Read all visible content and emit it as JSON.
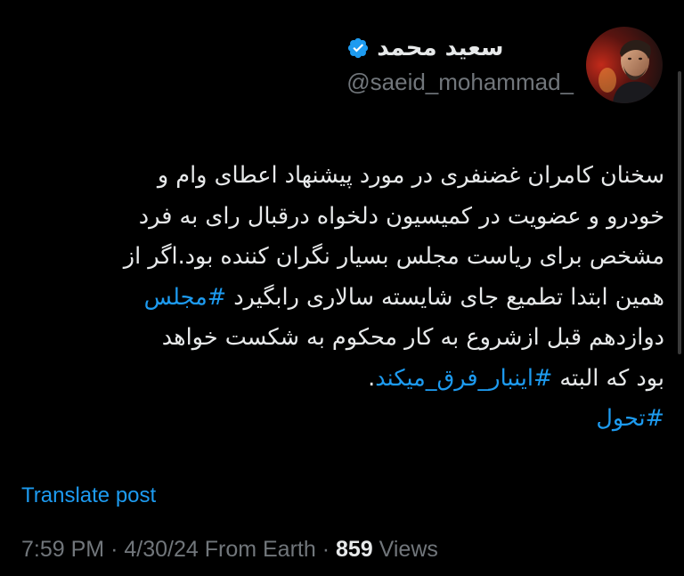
{
  "author": {
    "display_name": "سعید محمد",
    "handle": "@saeid_mohammad_",
    "verified": true,
    "verified_color": "#1d9bf0",
    "avatar_icon": "profile-photo"
  },
  "more_icon": "ellipsis-icon",
  "tweet": {
    "lines": [
      [
        {
          "text": "سخنان کامران غضنفری در مورد پیشنهاد اعطای وام و"
        }
      ],
      [
        {
          "text": "خودرو و عضویت در کمیسیون دلخواه درقبال رای به فرد"
        }
      ],
      [
        {
          "text": "مشخص برای ریاست مجلس بسیار نگران کننده بود.اگر از"
        }
      ],
      [
        {
          "text": "همین ابتدا تطمیع جای شایسته سالاری رابگیرد "
        },
        {
          "text": "#مجلس",
          "tag": true
        }
      ],
      [
        {
          "text": "دوازدهم قبل ازشروع به کار محکوم به شکست خواهد"
        }
      ],
      [
        {
          "text": "بود که البته "
        },
        {
          "text": "#اینبار_فرق_میکند",
          "tag": true
        },
        {
          "text": "."
        }
      ],
      [
        {
          "text": "#تحول",
          "tag": true
        }
      ]
    ]
  },
  "translate_label": "Translate post",
  "meta": {
    "time": "7:59 PM",
    "separator": "·",
    "date": "4/30/24",
    "source": "From Earth",
    "views_count": "859",
    "views_label": "Views"
  },
  "colors": {
    "background": "#000000",
    "text": "#e7e9ea",
    "muted": "#71767b",
    "accent": "#1d9bf0"
  }
}
